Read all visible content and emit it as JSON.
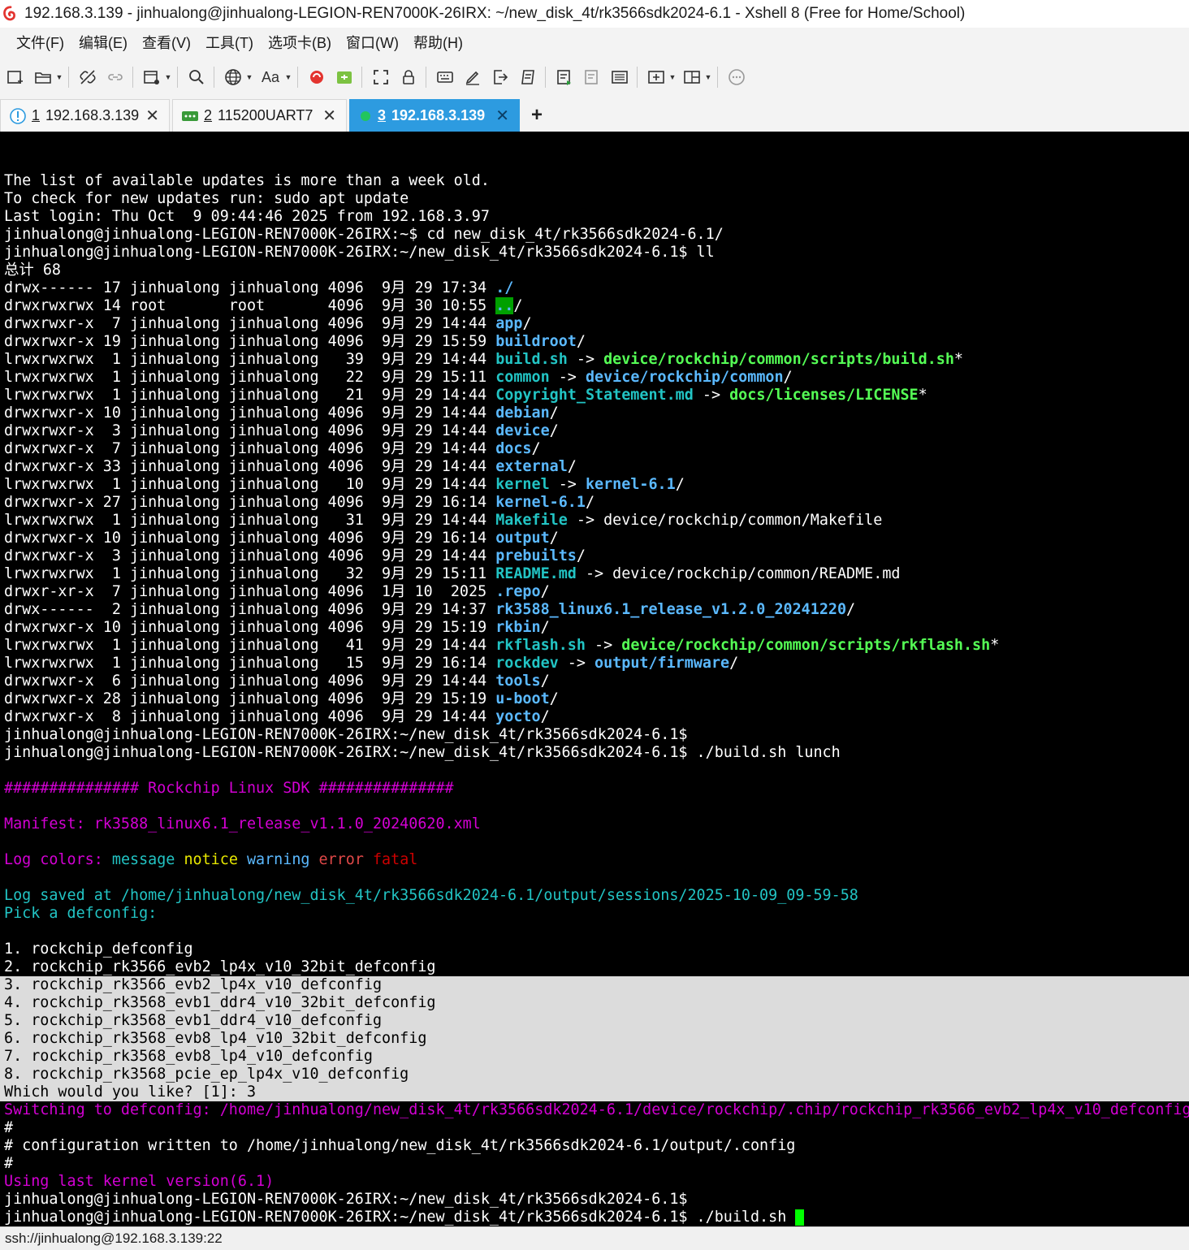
{
  "window": {
    "title": "192.168.3.139 - jinhualong@jinhualong-LEGION-REN7000K-26IRX: ~/new_disk_4t/rk3566sdk2024-6.1 - Xshell 8 (Free for Home/School)"
  },
  "menu": [
    "文件(F)",
    "编辑(E)",
    "查看(V)",
    "工具(T)",
    "选项卡(B)",
    "窗口(W)",
    "帮助(H)"
  ],
  "toolbar": {
    "icons": [
      "new-session-icon",
      "open-folder-icon",
      "disconnect-icon",
      "reconnect-icon",
      "new-window-icon",
      "search-icon",
      "globe-icon",
      "font-icon",
      "xshell-logo-icon",
      "xftp-icon",
      "fullscreen-icon",
      "lock-icon",
      "keyboard-icon",
      "pen-icon",
      "login-script-icon",
      "macro-icon",
      "compose-icon",
      "compose-bar-icon",
      "session-list-icon",
      "new-tab-icon",
      "layout-icon",
      "chat-icon"
    ],
    "font_label": "Aa"
  },
  "tabs": [
    {
      "num": "1",
      "label": "192.168.3.139",
      "icon": "info-icon",
      "active": false
    },
    {
      "num": "2",
      "label": "115200UART7",
      "icon": "serial-icon",
      "active": false
    },
    {
      "num": "3",
      "label": "192.168.3.139",
      "icon": "status-dot-icon",
      "active": true
    }
  ],
  "tab_close_glyph": "✕",
  "tab_add_glyph": "+",
  "colors": {
    "blue": "#5bb9ff",
    "green": "#55ff55",
    "magenta": "#d400d4",
    "cyan": "#22c4c4",
    "yellow": "#e8e800",
    "red": "#e04848",
    "fatal": "#cc0000",
    "sel_bg": "#dcdcdc",
    "tab_active": "#2d9be0",
    "cursor": "#00ff00"
  },
  "terminal": {
    "lines": [
      [],
      [
        {
          "t": "The list of available updates is more than a week old."
        }
      ],
      [
        {
          "t": "To check for new updates run: sudo apt update"
        }
      ],
      [
        {
          "t": "Last login: Thu Oct  9 09:44:46 2025 from 192.168.3.97"
        }
      ],
      [
        {
          "t": "jinhualong@jinhualong-LEGION-REN7000K-26IRX:~$ cd new_disk_4t/rk3566sdk2024-6.1/"
        }
      ],
      [
        {
          "t": "jinhualong@jinhualong-LEGION-REN7000K-26IRX:~/new_disk_4t/rk3566sdk2024-6.1$ ll"
        }
      ],
      [
        {
          "t": "总计 68"
        }
      ],
      [
        {
          "t": "drwx------ 17 jinhualong jinhualong 4096  9月 29 17:34 "
        },
        {
          "t": "./",
          "c": "blue",
          "b": true
        }
      ],
      [
        {
          "t": "drwxrwxrwx 14 root       root       4096  9月 30 10:55 "
        },
        {
          "t": "..",
          "c": "blue",
          "bg": "#00a000",
          "b": true
        },
        {
          "t": "/"
        }
      ],
      [
        {
          "t": "drwxrwxr-x  7 jinhualong jinhualong 4096  9月 29 14:44 "
        },
        {
          "t": "app",
          "c": "blue",
          "b": true
        },
        {
          "t": "/"
        }
      ],
      [
        {
          "t": "drwxrwxr-x 19 jinhualong jinhualong 4096  9月 29 15:59 "
        },
        {
          "t": "buildroot",
          "c": "blue",
          "b": true
        },
        {
          "t": "/"
        }
      ],
      [
        {
          "t": "lrwxrwxrwx  1 jinhualong jinhualong   39  9月 29 14:44 "
        },
        {
          "t": "build.sh",
          "c": "cyan",
          "b": true
        },
        {
          "t": " -> "
        },
        {
          "t": "device/rockchip/common/scripts/build.sh",
          "c": "green",
          "b": true
        },
        {
          "t": "*"
        }
      ],
      [
        {
          "t": "lrwxrwxrwx  1 jinhualong jinhualong   22  9月 29 15:11 "
        },
        {
          "t": "common",
          "c": "cyan",
          "b": true
        },
        {
          "t": " -> "
        },
        {
          "t": "device/rockchip/common",
          "c": "blue",
          "b": true
        },
        {
          "t": "/"
        }
      ],
      [
        {
          "t": "lrwxrwxrwx  1 jinhualong jinhualong   21  9月 29 14:44 "
        },
        {
          "t": "Copyright_Statement.md",
          "c": "cyan",
          "b": true
        },
        {
          "t": " -> "
        },
        {
          "t": "docs/licenses/LICENSE",
          "c": "green",
          "b": true
        },
        {
          "t": "*"
        }
      ],
      [
        {
          "t": "drwxrwxr-x 10 jinhualong jinhualong 4096  9月 29 14:44 "
        },
        {
          "t": "debian",
          "c": "blue",
          "b": true
        },
        {
          "t": "/"
        }
      ],
      [
        {
          "t": "drwxrwxr-x  3 jinhualong jinhualong 4096  9月 29 14:44 "
        },
        {
          "t": "device",
          "c": "blue",
          "b": true
        },
        {
          "t": "/"
        }
      ],
      [
        {
          "t": "drwxrwxr-x  7 jinhualong jinhualong 4096  9月 29 14:44 "
        },
        {
          "t": "docs",
          "c": "blue",
          "b": true
        },
        {
          "t": "/"
        }
      ],
      [
        {
          "t": "drwxrwxr-x 33 jinhualong jinhualong 4096  9月 29 14:44 "
        },
        {
          "t": "external",
          "c": "blue",
          "b": true
        },
        {
          "t": "/"
        }
      ],
      [
        {
          "t": "lrwxrwxrwx  1 jinhualong jinhualong   10  9月 29 14:44 "
        },
        {
          "t": "kernel",
          "c": "cyan",
          "b": true
        },
        {
          "t": " -> "
        },
        {
          "t": "kernel-6.1",
          "c": "blue",
          "b": true
        },
        {
          "t": "/"
        }
      ],
      [
        {
          "t": "drwxrwxr-x 27 jinhualong jinhualong 4096  9月 29 16:14 "
        },
        {
          "t": "kernel-6.1",
          "c": "blue",
          "b": true
        },
        {
          "t": "/"
        }
      ],
      [
        {
          "t": "lrwxrwxrwx  1 jinhualong jinhualong   31  9月 29 14:44 "
        },
        {
          "t": "Makefile",
          "c": "cyan",
          "b": true
        },
        {
          "t": " -> device/rockchip/common/Makefile"
        }
      ],
      [
        {
          "t": "drwxrwxr-x 10 jinhualong jinhualong 4096  9月 29 16:14 "
        },
        {
          "t": "output",
          "c": "blue",
          "b": true
        },
        {
          "t": "/"
        }
      ],
      [
        {
          "t": "drwxrwxr-x  3 jinhualong jinhualong 4096  9月 29 14:44 "
        },
        {
          "t": "prebuilts",
          "c": "blue",
          "b": true
        },
        {
          "t": "/"
        }
      ],
      [
        {
          "t": "lrwxrwxrwx  1 jinhualong jinhualong   32  9月 29 15:11 "
        },
        {
          "t": "README.md",
          "c": "cyan",
          "b": true
        },
        {
          "t": " -> device/rockchip/common/README.md"
        }
      ],
      [
        {
          "t": "drwxr-xr-x  7 jinhualong jinhualong 4096  1月 10  2025 "
        },
        {
          "t": ".repo",
          "c": "blue",
          "b": true
        },
        {
          "t": "/"
        }
      ],
      [
        {
          "t": "drwx------  2 jinhualong jinhualong 4096  9月 29 14:37 "
        },
        {
          "t": "rk3588_linux6.1_release_v1.2.0_20241220",
          "c": "blue",
          "b": true
        },
        {
          "t": "/"
        }
      ],
      [
        {
          "t": "drwxrwxr-x 10 jinhualong jinhualong 4096  9月 29 15:19 "
        },
        {
          "t": "rkbin",
          "c": "blue",
          "b": true
        },
        {
          "t": "/"
        }
      ],
      [
        {
          "t": "lrwxrwxrwx  1 jinhualong jinhualong   41  9月 29 14:44 "
        },
        {
          "t": "rkflash.sh",
          "c": "cyan",
          "b": true
        },
        {
          "t": " -> "
        },
        {
          "t": "device/rockchip/common/scripts/rkflash.sh",
          "c": "green",
          "b": true
        },
        {
          "t": "*"
        }
      ],
      [
        {
          "t": "lrwxrwxrwx  1 jinhualong jinhualong   15  9月 29 16:14 "
        },
        {
          "t": "rockdev",
          "c": "cyan",
          "b": true
        },
        {
          "t": " -> "
        },
        {
          "t": "output/firmware",
          "c": "blue",
          "b": true
        },
        {
          "t": "/"
        }
      ],
      [
        {
          "t": "drwxrwxr-x  6 jinhualong jinhualong 4096  9月 29 14:44 "
        },
        {
          "t": "tools",
          "c": "blue",
          "b": true
        },
        {
          "t": "/"
        }
      ],
      [
        {
          "t": "drwxrwxr-x 28 jinhualong jinhualong 4096  9月 29 15:19 "
        },
        {
          "t": "u-boot",
          "c": "blue",
          "b": true
        },
        {
          "t": "/"
        }
      ],
      [
        {
          "t": "drwxrwxr-x  8 jinhualong jinhualong 4096  9月 29 14:44 "
        },
        {
          "t": "yocto",
          "c": "blue",
          "b": true
        },
        {
          "t": "/"
        }
      ],
      [
        {
          "t": "jinhualong@jinhualong-LEGION-REN7000K-26IRX:~/new_disk_4t/rk3566sdk2024-6.1$"
        }
      ],
      [
        {
          "t": "jinhualong@jinhualong-LEGION-REN7000K-26IRX:~/new_disk_4t/rk3566sdk2024-6.1$ ./build.sh lunch"
        }
      ],
      [],
      [
        {
          "t": "############### Rockchip Linux SDK ###############",
          "c": "magenta"
        }
      ],
      [],
      [
        {
          "t": "Manifest: rk3588_linux6.1_release_v1.1.0_20240620.xml",
          "c": "magenta"
        }
      ],
      [],
      [
        {
          "t": "Log colors: ",
          "c": "magenta"
        },
        {
          "t": "message ",
          "c": "cyan"
        },
        {
          "t": "notice ",
          "c": "yellow"
        },
        {
          "t": "warning ",
          "c": "blue"
        },
        {
          "t": "error ",
          "c": "red"
        },
        {
          "t": "fatal",
          "c": "fatal"
        }
      ],
      [],
      [
        {
          "t": "Log saved at /home/jinhualong/new_disk_4t/rk3566sdk2024-6.1/output/sessions/2025-10-09_09-59-58",
          "c": "cyan"
        }
      ],
      [
        {
          "t": "Pick a defconfig:",
          "c": "cyan"
        }
      ],
      [],
      [
        {
          "t": "1. rockchip_defconfig"
        }
      ],
      [
        {
          "t": "2. rockchip_rk3566_evb2_lp4x_v10_32bit_defconfig"
        }
      ],
      [
        {
          "t": "3. rockchip_rk3566_evb2_lp4x_v10_defconfig",
          "sel": true
        }
      ],
      [
        {
          "t": "4. rockchip_rk3568_evb1_ddr4_v10_32bit_defconfig",
          "sel": true
        }
      ],
      [
        {
          "t": "5. rockchip_rk3568_evb1_ddr4_v10_defconfig",
          "sel": true
        }
      ],
      [
        {
          "t": "6. rockchip_rk3568_evb8_lp4_v10_32bit_defconfig",
          "sel": true
        }
      ],
      [
        {
          "t": "7. rockchip_rk3568_evb8_lp4_v10_defconfig",
          "sel": true
        }
      ],
      [
        {
          "t": "8. rockchip_rk3568_pcie_ep_lp4x_v10_defconfig",
          "sel": true
        }
      ],
      [
        {
          "t": "Which would you like? [1]: 3",
          "sel": true
        }
      ],
      [
        {
          "t": "Switching to defconfig: /home/jinhualong/new_disk_4t/rk3566sdk2024-6.1/device/rockchip/.chip/rockchip_rk3566_evb2_lp4x_v10_defconfig",
          "c": "magenta"
        }
      ],
      [
        {
          "t": "#"
        }
      ],
      [
        {
          "t": "# configuration written to /home/jinhualong/new_disk_4t/rk3566sdk2024-6.1/output/.config"
        }
      ],
      [
        {
          "t": "#"
        }
      ],
      [
        {
          "t": "Using last kernel version(6.1)",
          "c": "magenta"
        }
      ],
      [
        {
          "t": "jinhualong@jinhualong-LEGION-REN7000K-26IRX:~/new_disk_4t/rk3566sdk2024-6.1$"
        }
      ],
      [
        {
          "t": "jinhualong@jinhualong-LEGION-REN7000K-26IRX:~/new_disk_4t/rk3566sdk2024-6.1$ ./build.sh "
        },
        {
          "cursor": true
        }
      ]
    ]
  },
  "status": {
    "connection": "ssh://jinhualong@192.168.3.139:22"
  }
}
